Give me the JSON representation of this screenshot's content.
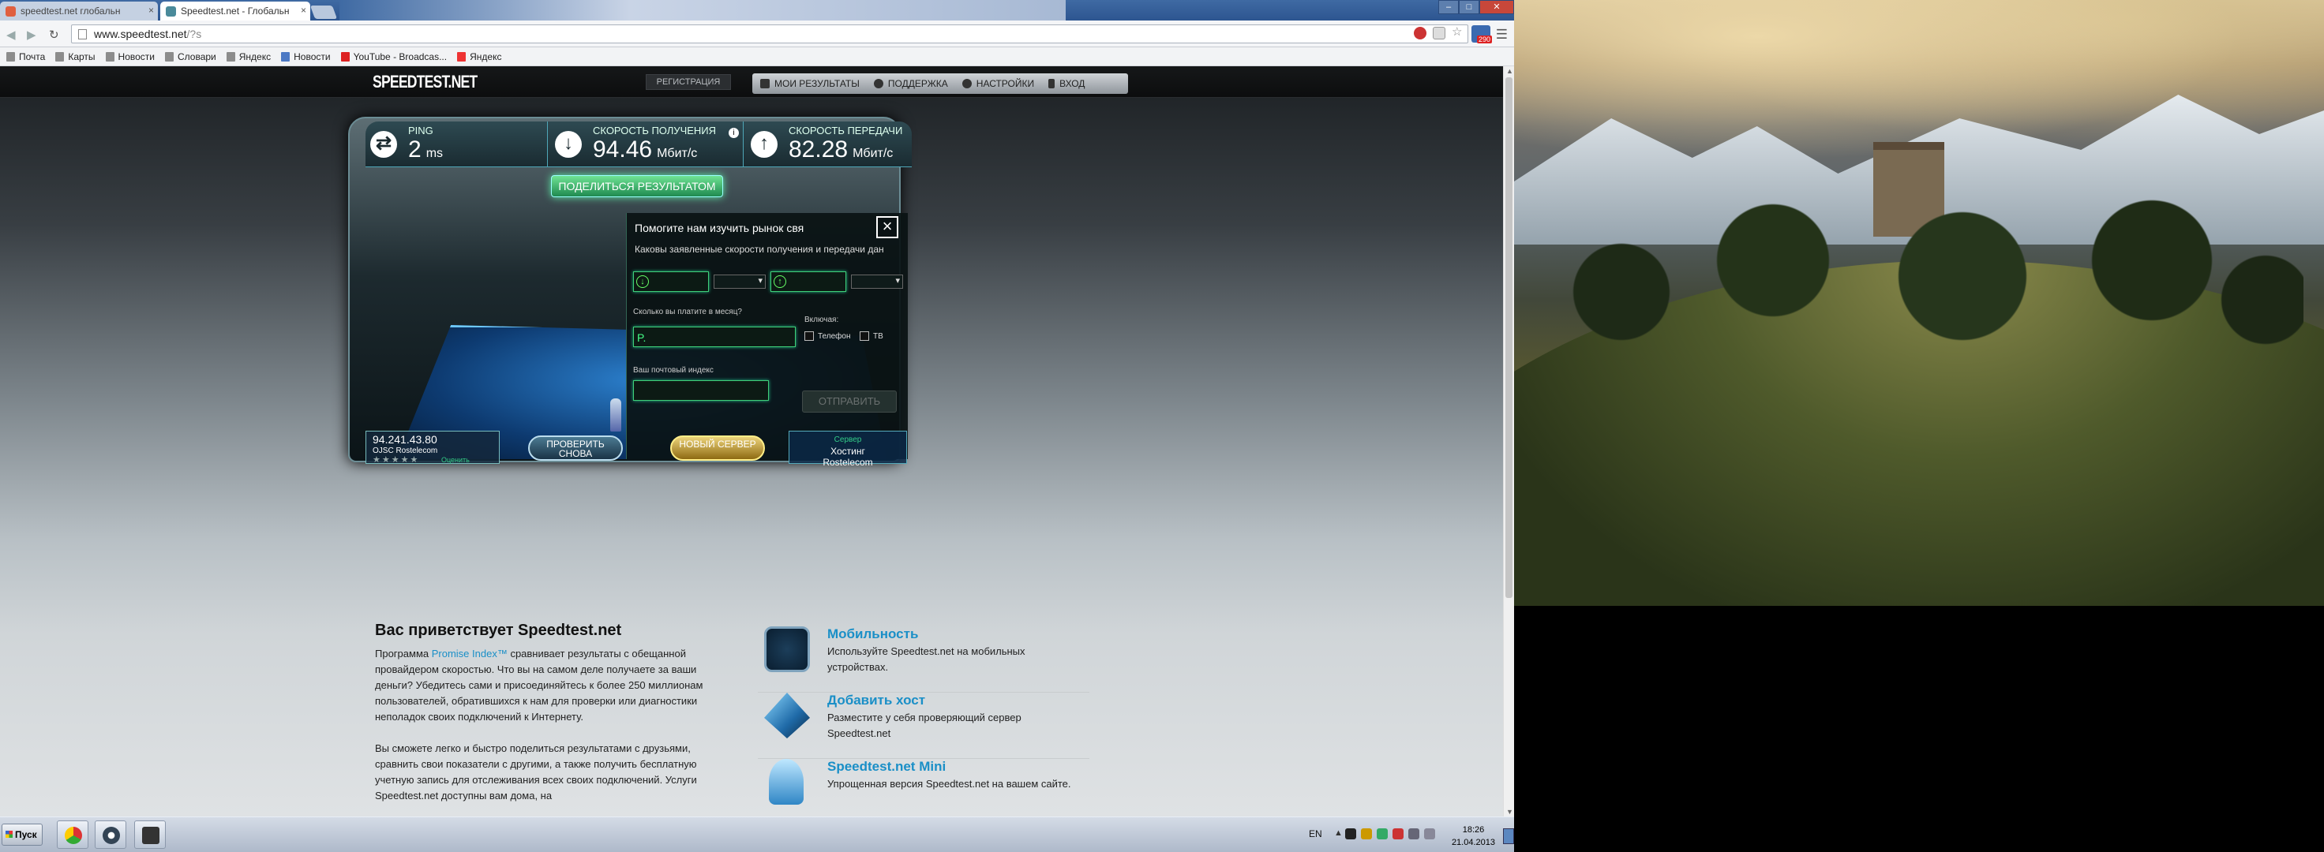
{
  "browser": {
    "tabs": [
      {
        "label": "speedtest.net глобальн",
        "active": false
      },
      {
        "label": "Speedtest.net - Глобальн",
        "active": true
      }
    ],
    "url": {
      "host": "www.speedtest.net",
      "path": "/?s"
    },
    "bookmarks": [
      {
        "label": "Почта",
        "icon": "folder-icon"
      },
      {
        "label": "Карты",
        "icon": "folder-icon"
      },
      {
        "label": "Новости",
        "icon": "folder-icon"
      },
      {
        "label": "Словари",
        "icon": "folder-icon"
      },
      {
        "label": "Яндекс",
        "icon": "folder-icon"
      },
      {
        "label": "Новости",
        "icon": "b-icon"
      },
      {
        "label": "YouTube - Broadcas...",
        "icon": "youtube-icon"
      },
      {
        "label": "Яндекс",
        "icon": "yandex-icon"
      }
    ],
    "extension_badge": "290"
  },
  "site": {
    "logo": "SPEEDTEST.NET",
    "register": "РЕГИСТРАЦИЯ",
    "nav": [
      {
        "label": "МОИ РЕЗУЛЬТАТЫ",
        "icon": "folder-icon"
      },
      {
        "label": "ПОДДЕРЖКА",
        "icon": "help-icon"
      },
      {
        "label": "НАСТРОЙКИ",
        "icon": "gear-icon"
      },
      {
        "label": "ВХОД",
        "icon": "person-icon"
      }
    ],
    "results": {
      "ping_label": "PING",
      "ping_value": "2",
      "ping_unit": "ms",
      "download_label": "СКОРОСТЬ ПОЛУЧЕНИЯ",
      "download_value": "94.46",
      "download_unit": "Мбит/с",
      "upload_label": "СКОРОСТЬ ПЕРЕДАЧИ",
      "upload_value": "82.28",
      "upload_unit": "Мбит/с",
      "share": "ПОДЕЛИТЬСЯ РЕЗУЛЬТАТОМ"
    },
    "survey": {
      "title": "Помогите нам изучить рынок свя",
      "question": "Каковы заявленные скорости получения и передачи дан",
      "pay_label": "Сколько вы платите в месяц?",
      "pay_value": "P.",
      "includes_label": "Включая:",
      "opt_phone": "Телефон",
      "opt_tv": "ТВ",
      "zip_label": "Ваш почтовый индекс",
      "submit": "ОТПРАВИТЬ"
    },
    "client": {
      "ip": "94.241.43.80",
      "isp": "OJSC Rostelecom",
      "rate": "Оценить"
    },
    "retest": "ПРОВЕРИТЬ СНОВА",
    "new_server": "НОВЫЙ СЕРВЕР",
    "server": {
      "tag": "Сервер",
      "city": "Хостинг",
      "host": "Rostelecom"
    },
    "welcome": {
      "title": "Вас приветствует Speedtest.net",
      "p1_before": "Программа ",
      "p1_link": "Promise Index™",
      "p1_after": " сравнивает результаты с обещанной провайдером скоростью. Что вы на самом деле получаете за ваши деньги? Убедитесь сами и присоединяйтесь к более 250 миллионам пользователей, обратившихся к нам для проверки или диагностики неполадок своих подключений к Интернету.",
      "p2": "Вы сможете легко и быстро поделиться результатами с друзьями, сравнить свои показатели с другими, а также получить бесплатную учетную запись для отслеживания всех своих подключений. Услуги Speedtest.net доступны вам дома, на"
    },
    "features": [
      {
        "title": "Мобильность",
        "text": "Используйте Speedtest.net на мобильных устройствах.",
        "icon": "speedometer-icon"
      },
      {
        "title": "Добавить хост",
        "text": "Разместите у себя проверяющий сервер Speedtest.net",
        "icon": "pyramid-icon"
      },
      {
        "title": "Speedtest.net Mini",
        "text": "Упрощенная версия Speedtest.net на вашем сайте.",
        "icon": "mini-gauge-icon"
      }
    ]
  },
  "taskbar": {
    "start": "Пуск",
    "apps": [
      "chrome-icon",
      "media-player-icon",
      "steam-icon"
    ],
    "lang": "EN",
    "time": "18:26",
    "date": "21.04.2013"
  }
}
